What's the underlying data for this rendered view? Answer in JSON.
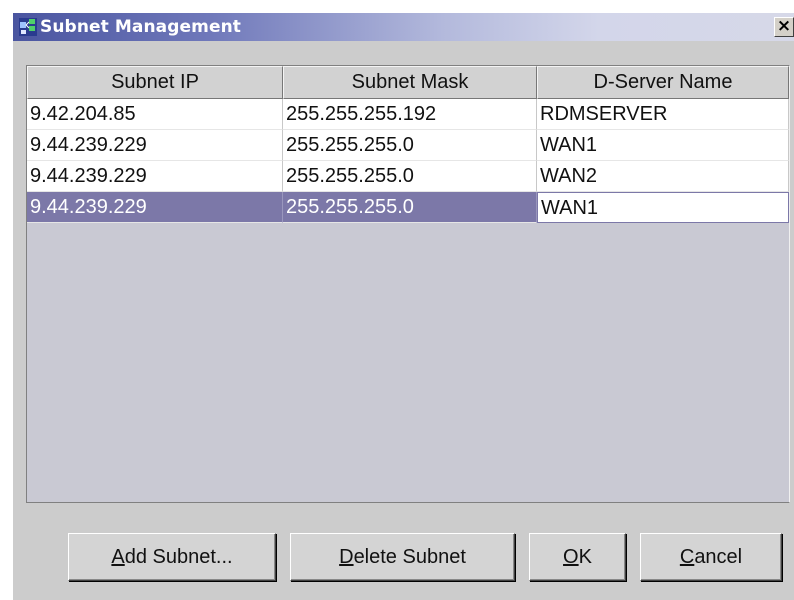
{
  "window": {
    "title": "Subnet Management",
    "close_glyph": "×",
    "icon": "subnet-app-icon",
    "title_gradient_start": "#4a55a0",
    "title_gradient_end": "#d6d8e8"
  },
  "table": {
    "columns": [
      "Subnet IP",
      "Subnet Mask",
      "D-Server Name"
    ],
    "rows": [
      {
        "ip": "9.42.204.85",
        "mask": "255.255.255.192",
        "server": "RDMSERVER"
      },
      {
        "ip": "9.44.239.229",
        "mask": "255.255.255.0",
        "server": "WAN1"
      },
      {
        "ip": "9.44.239.229",
        "mask": "255.255.255.0",
        "server": "WAN2"
      },
      {
        "ip": "9.44.239.229",
        "mask": "255.255.255.0",
        "server": "WAN1"
      }
    ],
    "selected_row": 3,
    "selection_color": "#7c78a8",
    "empty_area_color": "#c9c9d3"
  },
  "buttons": {
    "add": {
      "mnemonic": "A",
      "rest": "dd Subnet..."
    },
    "delete": {
      "mnemonic": "D",
      "rest": "elete Subnet"
    },
    "ok": {
      "mnemonic": "O",
      "rest": "K"
    },
    "cancel": {
      "mnemonic": "C",
      "rest": "ancel"
    }
  }
}
